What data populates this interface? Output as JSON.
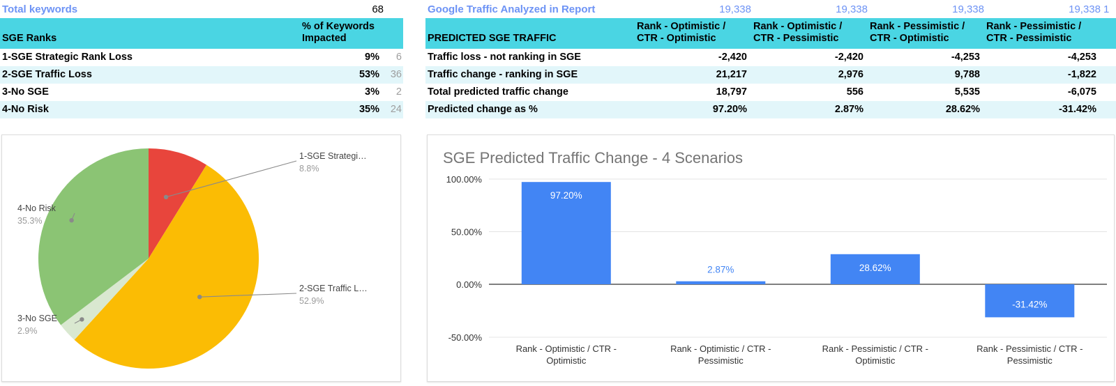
{
  "left_panel": {
    "kpi": {
      "label": "Total keywords",
      "value": "68"
    },
    "table": {
      "columns": [
        "SGE Ranks",
        "% of Keywords Impacted"
      ],
      "rows": [
        {
          "rank": "1-SGE Strategic Rank Loss",
          "pct": "9%",
          "count": "6"
        },
        {
          "rank": "2-SGE Traffic Loss",
          "pct": "53%",
          "count": "36"
        },
        {
          "rank": "3-No SGE",
          "pct": "3%",
          "count": "2"
        },
        {
          "rank": "4-No Risk",
          "pct": "35%",
          "count": "24"
        }
      ]
    }
  },
  "right_panel": {
    "kpi": {
      "label": "Google Traffic Analyzed in Report",
      "values": [
        "19,338",
        "19,338",
        "19,338",
        "19,338"
      ],
      "edge_clipped": "1"
    },
    "table": {
      "columns": [
        "PREDICTED SGE TRAFFIC",
        "Rank - Optimistic / CTR - Optimistic",
        "Rank - Optimistic / CTR - Pessimistic",
        "Rank - Pessimistic / CTR - Optimistic",
        "Rank - Pessimistic / CTR - Pessimistic"
      ],
      "rows": [
        {
          "metric": "Traffic loss - not ranking in SGE",
          "values": [
            "-2,420",
            "-2,420",
            "-4,253",
            "-4,253"
          ]
        },
        {
          "metric": "Traffic change - ranking in SGE",
          "values": [
            "21,217",
            "2,976",
            "9,788",
            "-1,822"
          ]
        },
        {
          "metric": "Total predicted traffic change",
          "values": [
            "18,797",
            "556",
            "5,535",
            "-6,075"
          ]
        },
        {
          "metric": "Predicted change as %",
          "values": [
            "97.20%",
            "2.87%",
            "28.62%",
            "-31.42%"
          ]
        }
      ]
    }
  },
  "chart_data": [
    {
      "type": "pie",
      "title": "",
      "legend": "callout-labels",
      "slices": [
        {
          "label": "1-SGE Strategic Rank Loss",
          "label_display": "1-SGE Strategi…",
          "pct_display": "8.8%",
          "value": 8.8,
          "color": "#e8453c"
        },
        {
          "label": "2-SGE Traffic Loss",
          "label_display": "2-SGE Traffic L…",
          "pct_display": "52.9%",
          "value": 52.9,
          "color": "#fbbc04"
        },
        {
          "label": "3-No SGE",
          "label_display": "3-No SGE",
          "pct_display": "2.9%",
          "value": 2.9,
          "color": "#d9e8d0"
        },
        {
          "label": "4-No Risk",
          "label_display": "4-No Risk",
          "pct_display": "35.3%",
          "value": 35.3,
          "color": "#8bc474"
        }
      ]
    },
    {
      "type": "bar",
      "title": "SGE Predicted Traffic Change - 4 Scenarios",
      "xlabel": "",
      "ylabel": "",
      "ylim": [
        -50,
        100
      ],
      "yticks": [
        "-50.00%",
        "0.00%",
        "50.00%",
        "100.00%"
      ],
      "grid": true,
      "bar_color": "#4285f4",
      "categories": [
        "Rank - Optimistic / CTR - Optimistic",
        "Rank - Optimistic / CTR - Pessimistic",
        "Rank - Pessimistic / CTR - Optimistic",
        "Rank - Pessimistic / CTR - Pessimistic"
      ],
      "category_lines": [
        [
          "Rank - Optimistic / CTR -",
          "Optimistic"
        ],
        [
          "Rank - Optimistic / CTR -",
          "Pessimistic"
        ],
        [
          "Rank - Pessimistic / CTR -",
          "Optimistic"
        ],
        [
          "Rank - Pessimistic / CTR -",
          "Pessimistic"
        ]
      ],
      "values": [
        97.2,
        2.87,
        28.62,
        -31.42
      ],
      "value_labels": [
        "97.20%",
        "2.87%",
        "28.62%",
        "-31.42%"
      ]
    }
  ],
  "colors": {
    "header_teal": "#4ad5e3",
    "alt_row": "#e2f6fa",
    "kpi_blue": "#6d93f5",
    "bar_blue": "#4285f4",
    "pie_red": "#e8453c",
    "pie_amber": "#fbbc04",
    "pie_pale_green": "#d9e8d0",
    "pie_green": "#8bc474"
  }
}
